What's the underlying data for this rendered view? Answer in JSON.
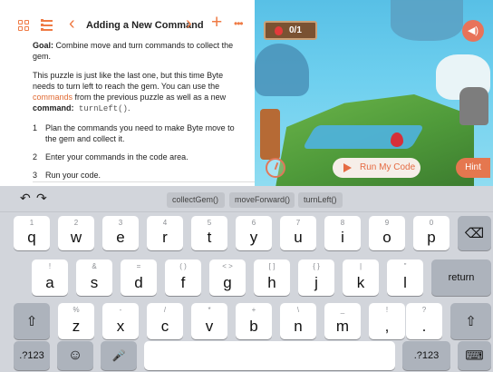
{
  "lesson": {
    "title": "Adding a New Command",
    "goal_label": "Goal:",
    "goal_text": " Combine move and turn commands to collect the gem.",
    "para_a": "This puzzle is just like the last one, but this time Byte needs to turn left to reach the gem. You can use the ",
    "para_link": "commands",
    "para_b": " from the previous puzzle as well as a new ",
    "para_bold": "command:",
    "para_code": " turnLeft()",
    "para_end": ".",
    "steps": [
      {
        "num": "1",
        "text": "Plan the commands you need to make Byte move to the gem and collect it."
      },
      {
        "num": "2",
        "text": "Enter your commands in the code area."
      },
      {
        "num": "3",
        "text": "Run your code."
      }
    ]
  },
  "nav": {
    "prev": "‹",
    "next": "›",
    "add": "+",
    "more": "•••"
  },
  "game": {
    "gem_count": "0/1",
    "run_label": "Run My Code",
    "hint_label": "Hint",
    "sound_glyph": "◀)"
  },
  "keyboard": {
    "undo": "↶",
    "redo": "↷",
    "suggestions": [
      "collectGem()",
      "moveForward()",
      "turnLeft()"
    ],
    "row1": [
      {
        "main": "q",
        "sub": "1"
      },
      {
        "main": "w",
        "sub": "2"
      },
      {
        "main": "e",
        "sub": "3"
      },
      {
        "main": "r",
        "sub": "4"
      },
      {
        "main": "t",
        "sub": "5"
      },
      {
        "main": "y",
        "sub": "6"
      },
      {
        "main": "u",
        "sub": "7"
      },
      {
        "main": "i",
        "sub": "8"
      },
      {
        "main": "o",
        "sub": "9"
      },
      {
        "main": "p",
        "sub": "0"
      }
    ],
    "row2": [
      {
        "main": "a",
        "sub": "!"
      },
      {
        "main": "s",
        "sub": "&"
      },
      {
        "main": "d",
        "sub": "="
      },
      {
        "main": "f",
        "sub": "( )"
      },
      {
        "main": "g",
        "sub": "< >"
      },
      {
        "main": "h",
        "sub": "[ ]"
      },
      {
        "main": "j",
        "sub": "{ }"
      },
      {
        "main": "k",
        "sub": "|"
      },
      {
        "main": "l",
        "sub": "\""
      }
    ],
    "row3": [
      {
        "main": "z",
        "sub": "%"
      },
      {
        "main": "x",
        "sub": "-"
      },
      {
        "main": "c",
        "sub": "/"
      },
      {
        "main": "v",
        "sub": "*"
      },
      {
        "main": "b",
        "sub": "+"
      },
      {
        "main": "n",
        "sub": "\\"
      },
      {
        "main": "m",
        "sub": "_"
      },
      {
        "main": ",",
        "sub": "!"
      },
      {
        "main": ".",
        "sub": "?"
      }
    ],
    "return_label": "return",
    "numbers_label": ".?123",
    "backspace_glyph": "⌫",
    "shift_glyph": "⇧",
    "emoji_glyph": "☺",
    "mic_glyph": "🎤",
    "hide_glyph": "⌨"
  }
}
